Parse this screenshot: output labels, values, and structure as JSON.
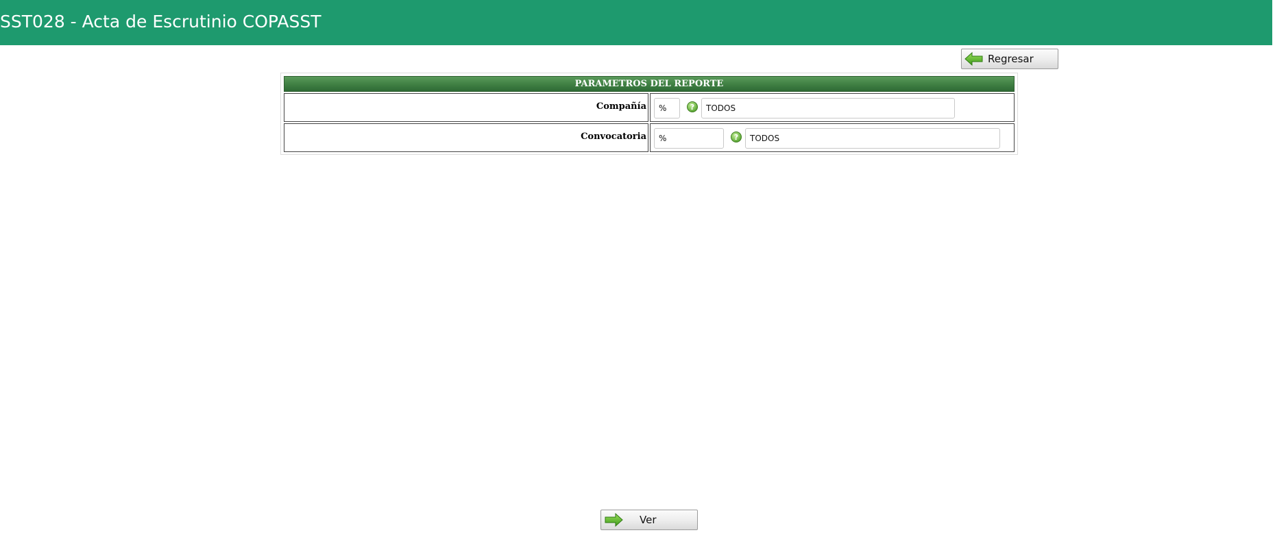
{
  "header": {
    "title": "SST028 - Acta de Escrutinio COPASST",
    "background_color": "#1e9a6e"
  },
  "toolbar": {
    "back_label": "Regresar",
    "back_icon": "arrow-left-icon"
  },
  "params": {
    "title": "PARAMETROS DEL REPORTE",
    "rows": [
      {
        "label": "Compañía",
        "code_value": "%",
        "help_icon": "help-question-icon",
        "description_value": "TODOS"
      },
      {
        "label": "Convocatoria",
        "code_value": "%",
        "help_icon": "help-question-icon",
        "description_value": "TODOS"
      }
    ]
  },
  "footer": {
    "view_label": "Ver",
    "view_icon": "arrow-right-icon"
  }
}
